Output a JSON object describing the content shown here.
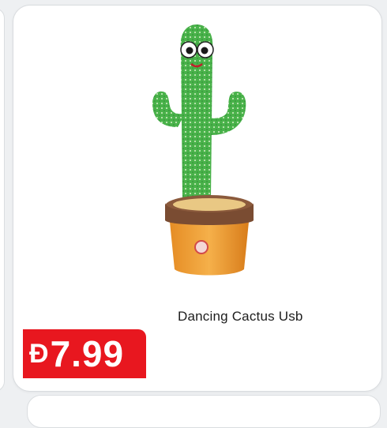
{
  "product": {
    "title": "Dancing Cactus Usb",
    "image_icon": "dancing-cactus-toy",
    "price": {
      "currency_symbol": "Đ",
      "amount": "7.99"
    }
  },
  "colors": {
    "price_badge": "#e8171f",
    "card_background": "#ffffff",
    "page_background": "#eef0f2"
  }
}
